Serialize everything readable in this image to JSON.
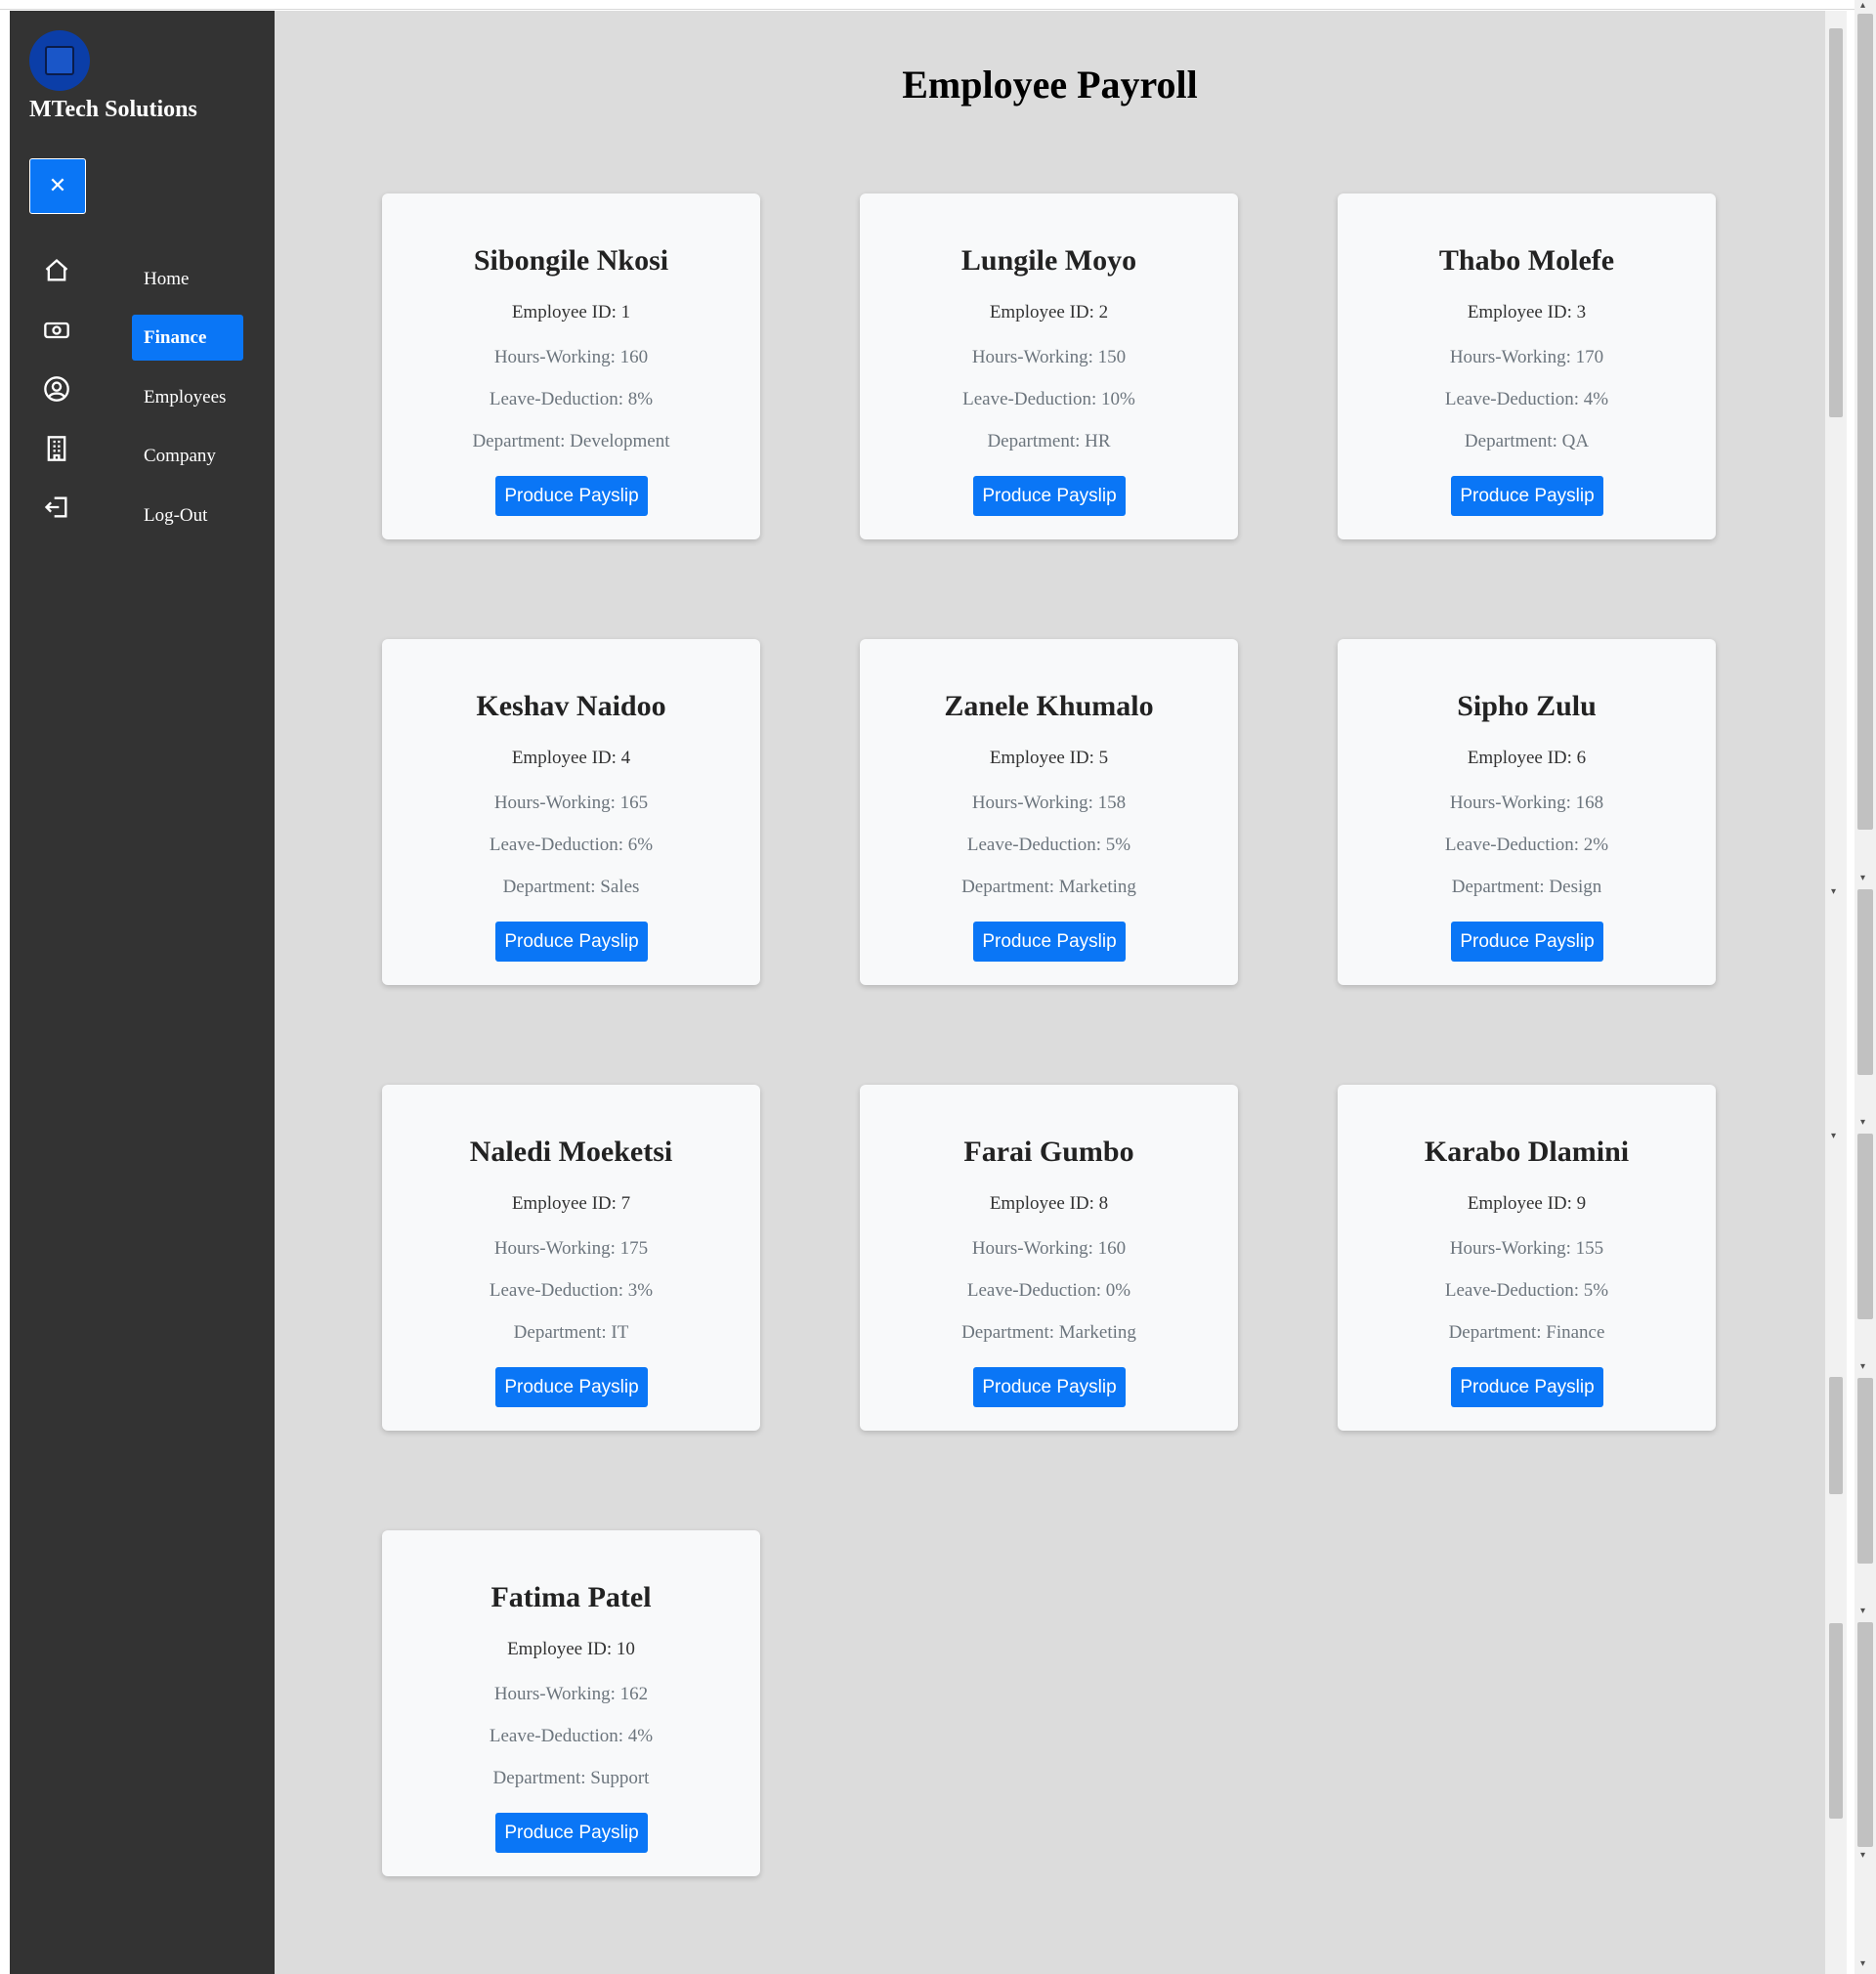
{
  "sidebar": {
    "brand": "MTech Solutions",
    "close_label": "✕",
    "nav": [
      {
        "label": "Home",
        "icon": "home-icon"
      },
      {
        "label": "Finance",
        "icon": "cash-icon",
        "active": true
      },
      {
        "label": "Employees",
        "icon": "user-circle-icon"
      },
      {
        "label": "Company",
        "icon": "building-icon"
      },
      {
        "label": "Log-Out",
        "icon": "logout-icon"
      }
    ]
  },
  "main": {
    "title": "Employee Payroll",
    "button_label": "Produce Payslip",
    "employees": [
      {
        "name": "Sibongile Nkosi",
        "id_text": "Employee ID: 1",
        "hours_text": "Hours-Working: 160",
        "leave_text": "Leave-Deduction: 8%",
        "dept_text": "Department: Development"
      },
      {
        "name": "Lungile Moyo",
        "id_text": "Employee ID: 2",
        "hours_text": "Hours-Working: 150",
        "leave_text": "Leave-Deduction: 10%",
        "dept_text": "Department: HR"
      },
      {
        "name": "Thabo Molefe",
        "id_text": "Employee ID: 3",
        "hours_text": "Hours-Working: 170",
        "leave_text": "Leave-Deduction: 4%",
        "dept_text": "Department: QA"
      },
      {
        "name": "Keshav Naidoo",
        "id_text": "Employee ID: 4",
        "hours_text": "Hours-Working: 165",
        "leave_text": "Leave-Deduction: 6%",
        "dept_text": "Department: Sales"
      },
      {
        "name": "Zanele Khumalo",
        "id_text": "Employee ID: 5",
        "hours_text": "Hours-Working: 158",
        "leave_text": "Leave-Deduction: 5%",
        "dept_text": "Department: Marketing"
      },
      {
        "name": "Sipho Zulu",
        "id_text": "Employee ID: 6",
        "hours_text": "Hours-Working: 168",
        "leave_text": "Leave-Deduction: 2%",
        "dept_text": "Department: Design"
      },
      {
        "name": "Naledi Moeketsi",
        "id_text": "Employee ID: 7",
        "hours_text": "Hours-Working: 175",
        "leave_text": "Leave-Deduction: 3%",
        "dept_text": "Department: IT"
      },
      {
        "name": "Farai Gumbo",
        "id_text": "Employee ID: 8",
        "hours_text": "Hours-Working: 160",
        "leave_text": "Leave-Deduction: 0%",
        "dept_text": "Department: Marketing"
      },
      {
        "name": "Karabo Dlamini",
        "id_text": "Employee ID: 9",
        "hours_text": "Hours-Working: 155",
        "leave_text": "Leave-Deduction: 5%",
        "dept_text": "Department: Finance"
      },
      {
        "name": "Fatima Patel",
        "id_text": "Employee ID: 10",
        "hours_text": "Hours-Working: 162",
        "leave_text": "Leave-Deduction: 4%",
        "dept_text": "Department: Support"
      }
    ]
  },
  "colors": {
    "accent": "#0a76f6",
    "sidebar_bg": "#333333",
    "main_bg": "#dcdcdc",
    "card_bg": "#f8f9fa"
  }
}
